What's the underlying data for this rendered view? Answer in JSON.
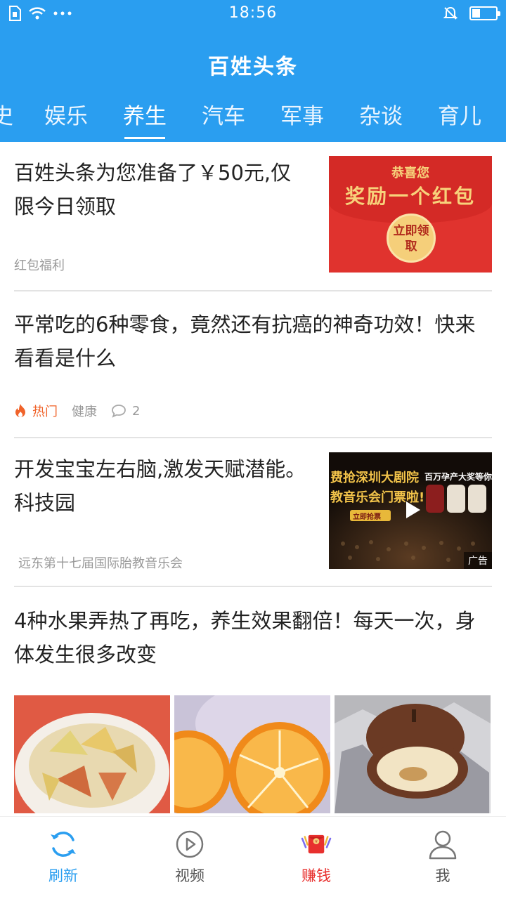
{
  "status": {
    "time": "18:56",
    "battery_level": 0.35,
    "icons": [
      "sim-icon",
      "wifi-icon",
      "more-dots-icon",
      "mute-icon",
      "battery-icon"
    ]
  },
  "header": {
    "title": "百姓头条",
    "background": "#2a9ef0"
  },
  "tabs": [
    {
      "label": "史"
    },
    {
      "label": "娱乐"
    },
    {
      "label": "养生",
      "active": true
    },
    {
      "label": "汽车"
    },
    {
      "label": "军事"
    },
    {
      "label": "杂谈"
    },
    {
      "label": "育儿"
    }
  ],
  "feed": [
    {
      "title": "百姓头条为您准备了￥50元,仅限今日领取",
      "source": "红包福利",
      "thumb": {
        "line1": "恭喜您",
        "line2": "奖励一个红包",
        "button": "立即领取"
      }
    },
    {
      "title": "平常吃的6种零食，竟然还有抗癌的神奇功效！快来看看是什么",
      "hot_label": "热门",
      "category": "健康",
      "comments": "2"
    },
    {
      "title": "开发宝宝左右脑,激发天赋潜能。科技园",
      "source": "远东第十七届国际胎教音乐会",
      "thumb": {
        "line1": "费抢深圳大剧院",
        "line2": "教音乐会门票啦!",
        "button": "立即抢票",
        "side": "百万孕产大奖等你",
        "badge": "广告"
      }
    },
    {
      "title": "4种水果弄热了再吃，养生效果翻倍！每天一次，身体发生很多改变",
      "photos": [
        "apple-slices-photo",
        "orange-halves-photo",
        "baked-pear-photo"
      ]
    }
  ],
  "bottom_nav": [
    {
      "label": "刷新",
      "icon": "refresh-icon",
      "active": true
    },
    {
      "label": "视频",
      "icon": "play-icon"
    },
    {
      "label": "赚钱",
      "icon": "red-envelope-icon"
    },
    {
      "label": "我",
      "icon": "user-icon"
    }
  ]
}
